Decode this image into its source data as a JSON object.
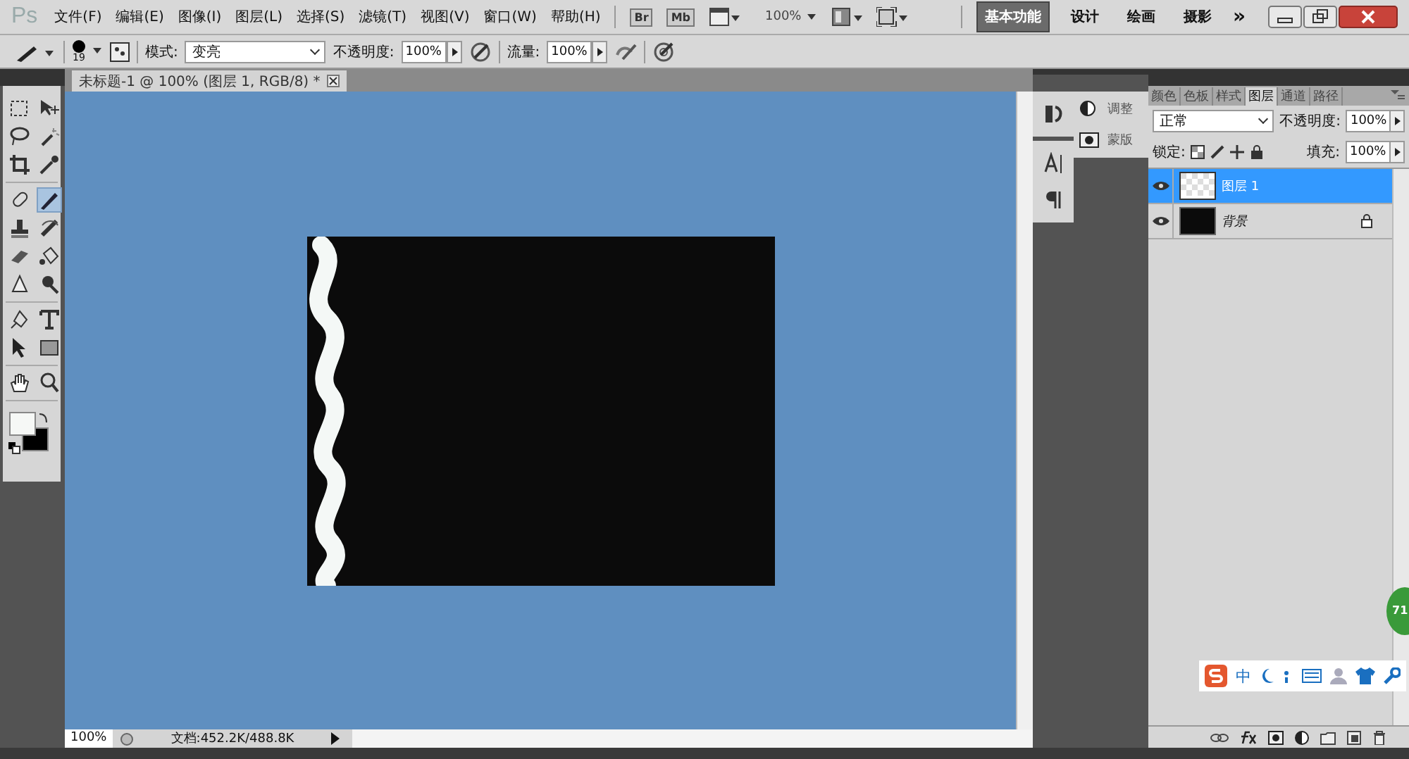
{
  "app": {
    "logo": "Ps"
  },
  "menu": {
    "items": [
      "文件(F)",
      "编辑(E)",
      "图像(I)",
      "图层(L)",
      "选择(S)",
      "滤镜(T)",
      "视图(V)",
      "窗口(W)",
      "帮助(H)"
    ],
    "bridge": "Br",
    "mini": "Mb",
    "zoom": "100%"
  },
  "workspaces": [
    {
      "label": "基本功能",
      "selected": true
    },
    {
      "label": "设计",
      "selected": false
    },
    {
      "label": "绘画",
      "selected": false
    },
    {
      "label": "摄影",
      "selected": false
    }
  ],
  "more": "»",
  "options": {
    "brush_size": "19",
    "mode_label": "模式:",
    "mode": "变亮",
    "opacity_label": "不透明度:",
    "opacity": "100%",
    "flow_label": "流量:",
    "flow": "100%"
  },
  "document": {
    "tab": "未标题-1 @ 100% (图层 1, RGB/8) *"
  },
  "status_bar": {
    "zoom": "100%",
    "info": "文档:452.2K/488.8K"
  },
  "mini_panels": [
    "调整",
    "蒙版"
  ],
  "panel_tabs": [
    {
      "label": "颜色",
      "selected": false
    },
    {
      "label": "色板",
      "selected": false
    },
    {
      "label": "样式",
      "selected": false
    },
    {
      "label": "图层",
      "selected": true
    },
    {
      "label": "通道",
      "selected": false
    },
    {
      "label": "路径",
      "selected": false
    }
  ],
  "layers_panel": {
    "blend": "正常",
    "opacity_label": "不透明度:",
    "opacity": "100%",
    "lock_label": "锁定:",
    "fill_label": "填充:",
    "fill": "100%"
  },
  "layers": [
    {
      "name": "图层 1",
      "selected": true,
      "kind": "transparent",
      "locked": false
    },
    {
      "name": "背景",
      "selected": false,
      "kind": "fill",
      "locked": true
    }
  ],
  "ime": {
    "label": "中"
  },
  "badge": {
    "label": "71"
  }
}
